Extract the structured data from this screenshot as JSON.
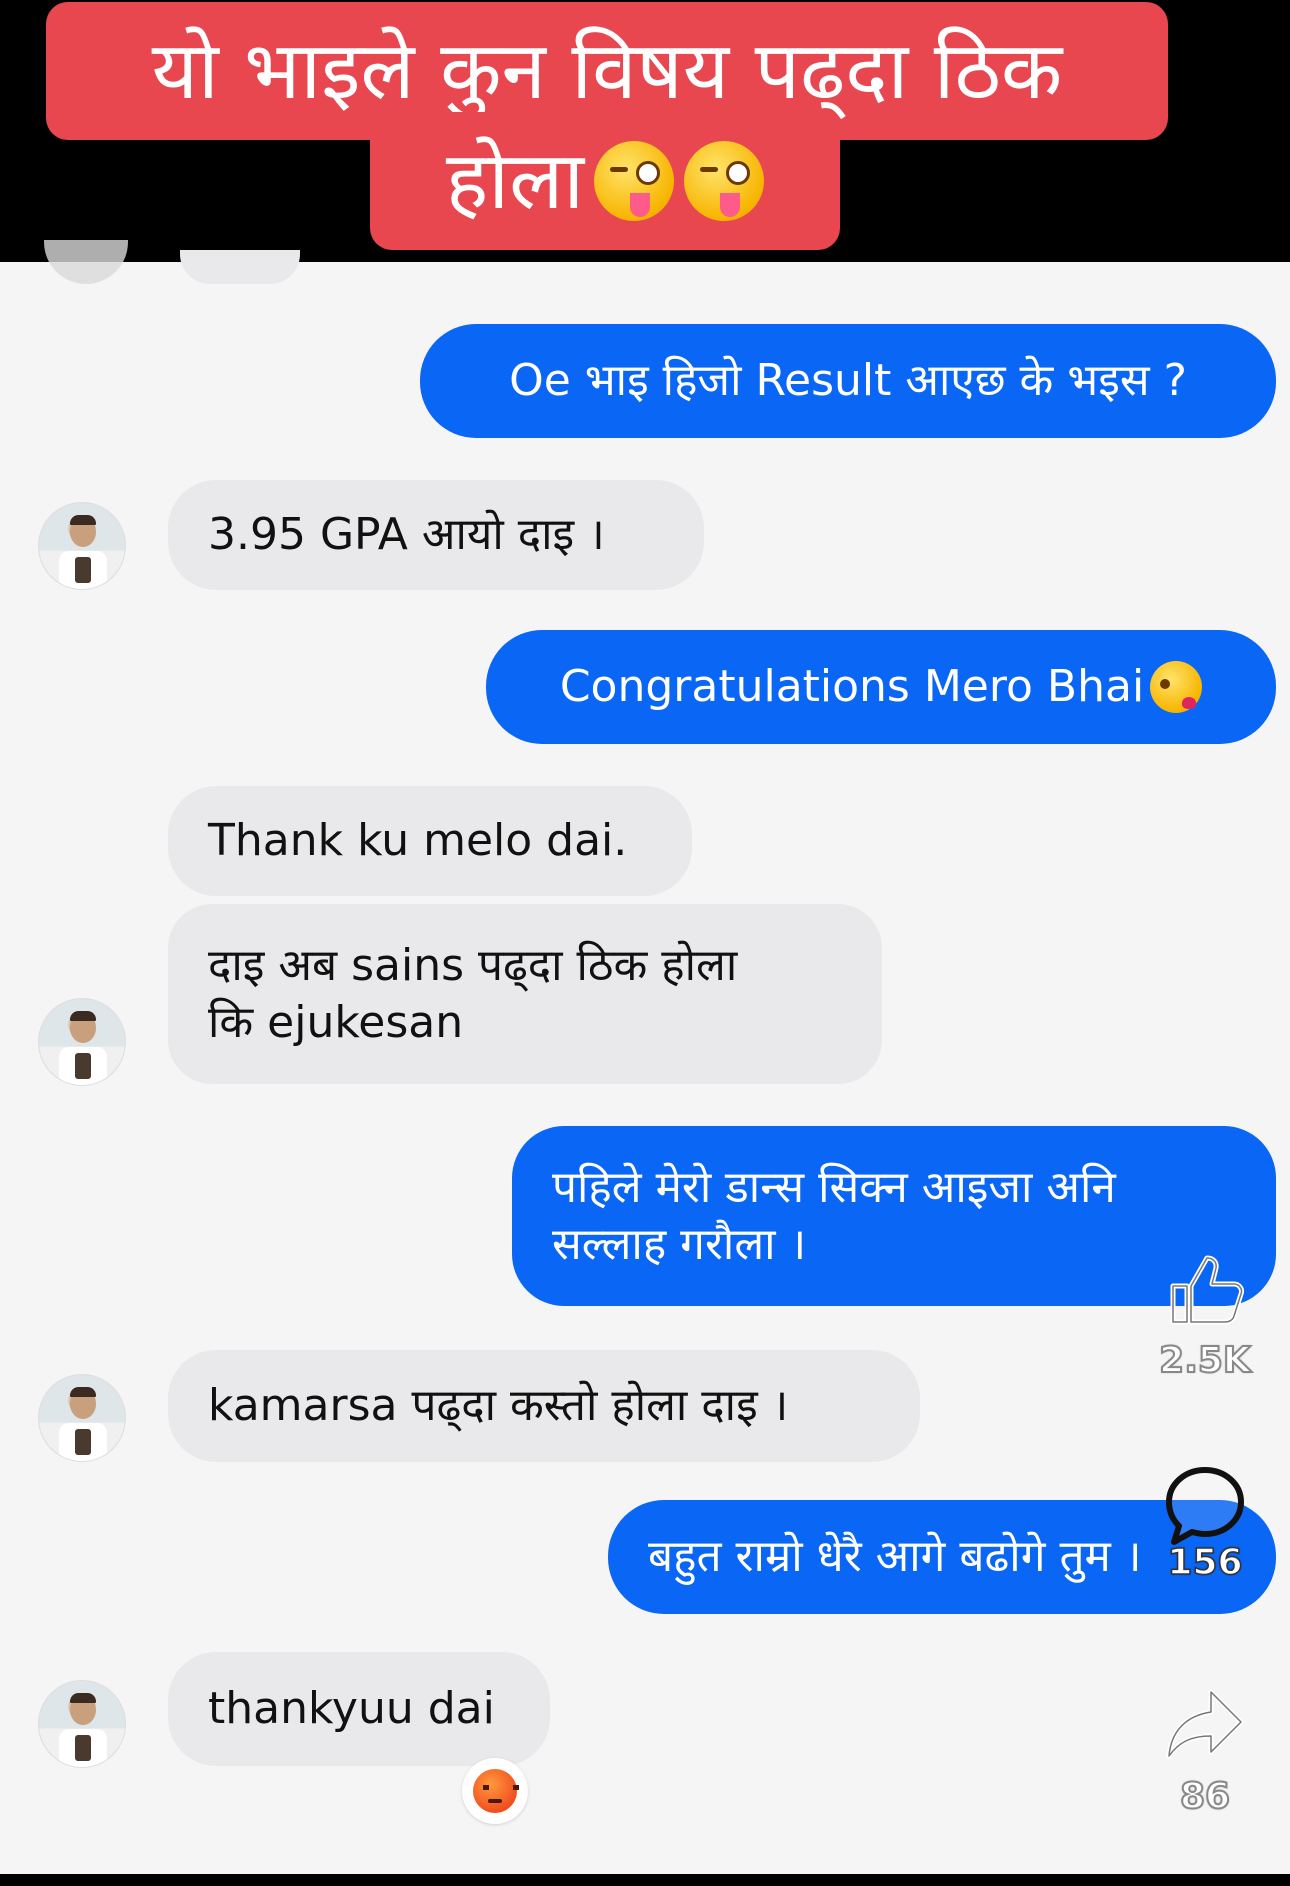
{
  "caption": {
    "line1": "यो भाइले कुन विषय पढ्दा ठिक",
    "line2": "होला",
    "emoji": "zany-face-emoji"
  },
  "messages": [
    {
      "side": "out",
      "text": "Oe भाइ हिजो Result आएछ के भइस ?"
    },
    {
      "side": "in",
      "text": "3.95 GPA आयो दाइ ।"
    },
    {
      "side": "out",
      "text": "Congratulations Mero Bhai",
      "emoji": "kissing-face-emoji"
    },
    {
      "side": "in",
      "text": "Thank ku melo dai."
    },
    {
      "side": "in",
      "lines": [
        "दाइ अब sains पढ्दा ठिक होला",
        "कि ejukesan"
      ]
    },
    {
      "side": "out",
      "lines": [
        "पहिले मेरो डान्स सिक्न आइजा अनि",
        "सल्लाह गरौला ।"
      ]
    },
    {
      "side": "in",
      "text": "kamarsa पढ्दा कस्तो होला दाइ ।"
    },
    {
      "side": "out",
      "text": "बहुत राम्रो धेरै आगे बढोगे तुम ।"
    },
    {
      "side": "in",
      "text": "thankyuu dai",
      "reaction": "angry-face-emoji"
    }
  ],
  "actions": {
    "like": {
      "icon": "thumbs-up-icon",
      "count": "2.5K"
    },
    "comment": {
      "icon": "comment-bubble-icon",
      "count": "156"
    },
    "share": {
      "icon": "share-arrow-icon",
      "count": "86"
    }
  },
  "colors": {
    "caption_bg": "#e8474f",
    "outgoing_bubble": "#0a66f4",
    "incoming_bubble": "#e9e9eb",
    "chat_bg": "#f5f5f5"
  }
}
